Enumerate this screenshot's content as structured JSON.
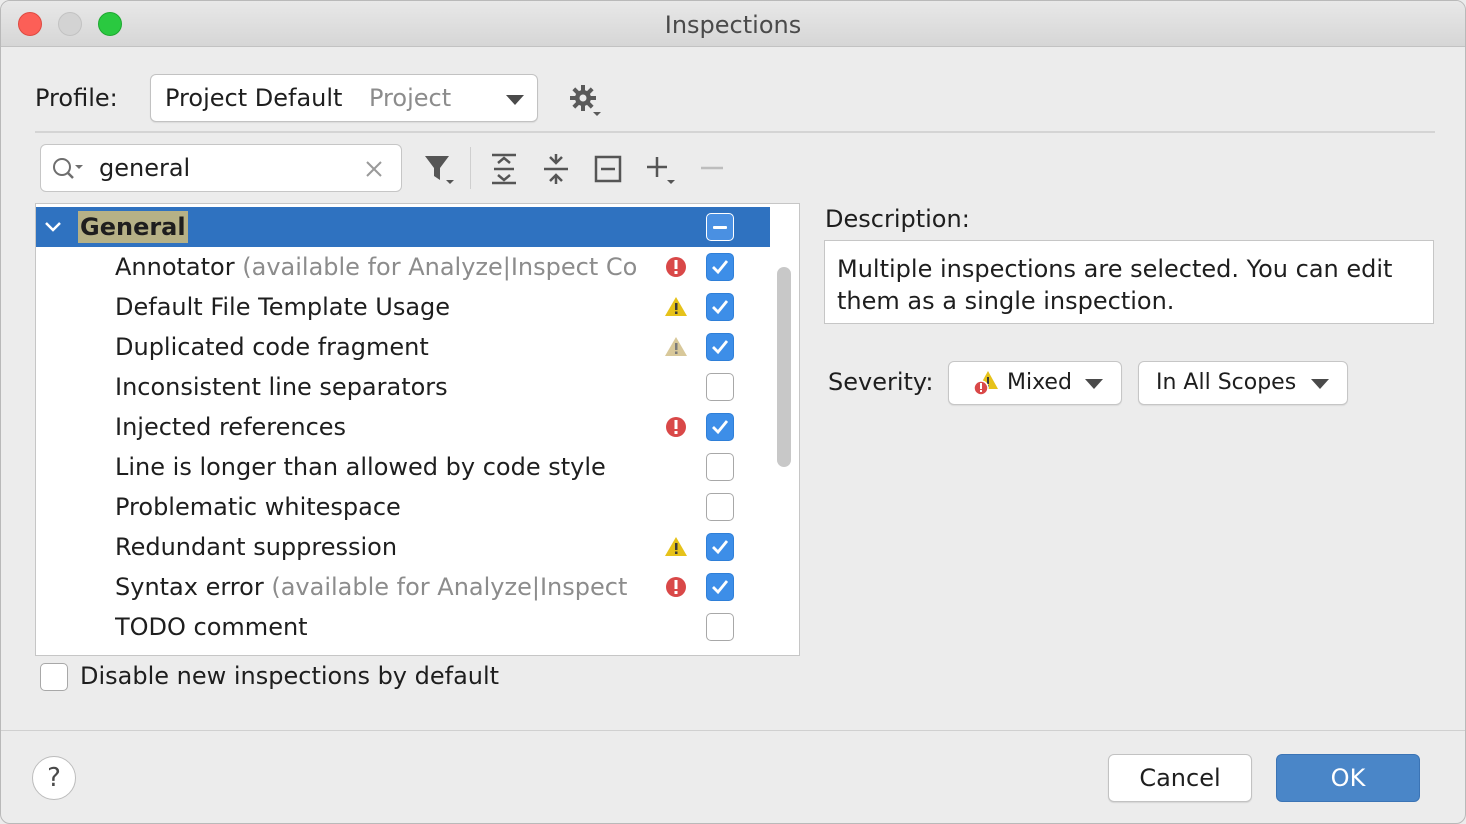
{
  "window": {
    "title": "Inspections"
  },
  "profile": {
    "label": "Profile:",
    "name": "Project Default",
    "scope": "Project"
  },
  "search": {
    "value": "general",
    "placeholder": ""
  },
  "tree": {
    "group": {
      "label": "General",
      "state": "mixed"
    },
    "items": [
      {
        "name": "Annotator",
        "hint": "(available for Analyze|Inspect Co",
        "severity": "error",
        "checked": true
      },
      {
        "name": "Default File Template Usage",
        "hint": "",
        "severity": "warning",
        "checked": true
      },
      {
        "name": "Duplicated code fragment",
        "hint": "",
        "severity": "weak-warning",
        "checked": true
      },
      {
        "name": "Inconsistent line separators",
        "hint": "",
        "severity": "none",
        "checked": false
      },
      {
        "name": "Injected references",
        "hint": "",
        "severity": "error",
        "checked": true
      },
      {
        "name": "Line is longer than allowed by code style",
        "hint": "",
        "severity": "none",
        "checked": false
      },
      {
        "name": "Problematic whitespace",
        "hint": "",
        "severity": "none",
        "checked": false
      },
      {
        "name": "Redundant suppression",
        "hint": "",
        "severity": "warning",
        "checked": true
      },
      {
        "name": "Syntax error",
        "hint": "(available for Analyze|Inspect",
        "severity": "error",
        "checked": true
      },
      {
        "name": "TODO comment",
        "hint": "",
        "severity": "none",
        "checked": false
      }
    ]
  },
  "disable_new": {
    "label": "Disable new inspections by default",
    "checked": false
  },
  "description": {
    "label": "Description:",
    "text": "Multiple inspections are selected. You can edit them as a single inspection."
  },
  "severity": {
    "label": "Severity:",
    "value": "Mixed",
    "scope": "In All Scopes"
  },
  "footer": {
    "help": "?",
    "cancel": "Cancel",
    "ok": "OK"
  },
  "colors": {
    "selection": "#2f72c0",
    "checkbox": "#3d8ee8",
    "error": "#d94848",
    "warning": "#e6c21a",
    "weak_warning": "#d8c89a",
    "ok_button": "#4a86c8"
  }
}
